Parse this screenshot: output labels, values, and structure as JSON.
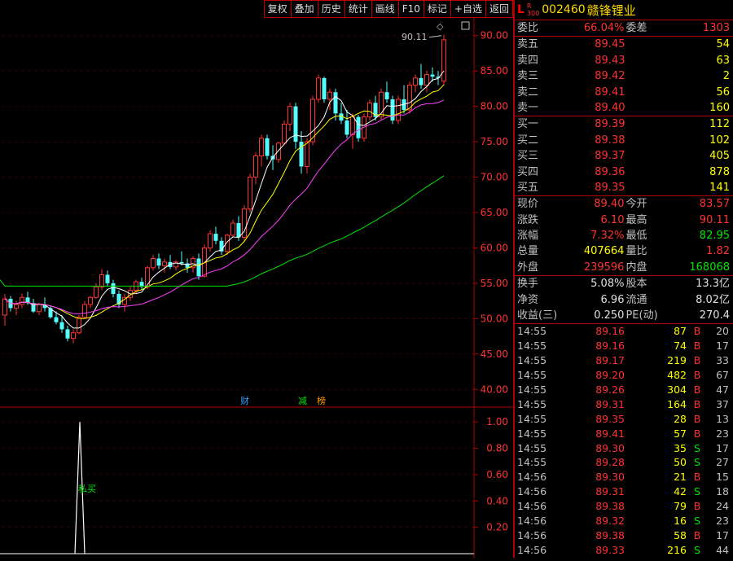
{
  "toolbar": {
    "items": [
      "复权",
      "叠加",
      "历史",
      "统计",
      "画线",
      "F10",
      "标记",
      "+自选",
      "返回"
    ]
  },
  "header": {
    "badge": "L",
    "market_top": "R",
    "market_bottom": "300",
    "code": "002460",
    "name": "赣锋锂业"
  },
  "order_book": {
    "weibi_label": "委比",
    "weibi": "66.04%",
    "weicha_label": "委差",
    "weicha": "1303",
    "asks": [
      {
        "label": "卖五",
        "price": "89.45",
        "vol": "54"
      },
      {
        "label": "卖四",
        "price": "89.43",
        "vol": "63"
      },
      {
        "label": "卖三",
        "price": "89.42",
        "vol": "2"
      },
      {
        "label": "卖二",
        "price": "89.41",
        "vol": "56"
      },
      {
        "label": "卖一",
        "price": "89.40",
        "vol": "160"
      }
    ],
    "bids": [
      {
        "label": "买一",
        "price": "89.39",
        "vol": "112"
      },
      {
        "label": "买二",
        "price": "89.38",
        "vol": "102"
      },
      {
        "label": "买三",
        "price": "89.37",
        "vol": "405"
      },
      {
        "label": "买四",
        "price": "89.36",
        "vol": "878"
      },
      {
        "label": "买五",
        "price": "89.35",
        "vol": "141"
      }
    ]
  },
  "quote": {
    "rows": [
      {
        "l1": "现价",
        "v1": "89.40",
        "l2": "今开",
        "v2": "83.57"
      },
      {
        "l1": "涨跌",
        "v1": "6.10",
        "l2": "最高",
        "v2": "90.11"
      },
      {
        "l1": "涨幅",
        "v1": "7.32%",
        "l2": "最低",
        "v2": "82.95"
      },
      {
        "l1": "总量",
        "v1": "407664",
        "l2": "量比",
        "v2": "1.82"
      },
      {
        "l1": "外盘",
        "v1": "239596",
        "l2": "内盘",
        "v2": "168068"
      }
    ],
    "rows2": [
      {
        "l1": "换手",
        "v1": "5.08%",
        "l2": "股本",
        "v2": "13.3亿"
      },
      {
        "l1": "净资",
        "v1": "6.96",
        "l2": "流通",
        "v2": "8.02亿"
      },
      {
        "l1": "收益(三)",
        "v1": "0.250",
        "l2": "PE(动)",
        "v2": "270.4"
      }
    ]
  },
  "ticks": [
    {
      "time": "14:55",
      "price": "89.16",
      "vol": "87",
      "bs": "B",
      "cnt": "20"
    },
    {
      "time": "14:55",
      "price": "89.16",
      "vol": "74",
      "bs": "B",
      "cnt": "17"
    },
    {
      "time": "14:55",
      "price": "89.17",
      "vol": "219",
      "bs": "B",
      "cnt": "33"
    },
    {
      "time": "14:55",
      "price": "89.20",
      "vol": "482",
      "bs": "B",
      "cnt": "67"
    },
    {
      "time": "14:55",
      "price": "89.26",
      "vol": "304",
      "bs": "B",
      "cnt": "47"
    },
    {
      "time": "14:55",
      "price": "89.31",
      "vol": "164",
      "bs": "B",
      "cnt": "37"
    },
    {
      "time": "14:55",
      "price": "89.35",
      "vol": "28",
      "bs": "B",
      "cnt": "13"
    },
    {
      "time": "14:55",
      "price": "89.41",
      "vol": "57",
      "bs": "B",
      "cnt": "23"
    },
    {
      "time": "14:55",
      "price": "89.30",
      "vol": "35",
      "bs": "S",
      "cnt": "17"
    },
    {
      "time": "14:55",
      "price": "89.28",
      "vol": "50",
      "bs": "S",
      "cnt": "27"
    },
    {
      "time": "14:56",
      "price": "89.30",
      "vol": "21",
      "bs": "B",
      "cnt": "15"
    },
    {
      "time": "14:56",
      "price": "89.31",
      "vol": "42",
      "bs": "S",
      "cnt": "18"
    },
    {
      "time": "14:56",
      "price": "89.38",
      "vol": "79",
      "bs": "B",
      "cnt": "24"
    },
    {
      "time": "14:56",
      "price": "89.32",
      "vol": "16",
      "bs": "S",
      "cnt": "23"
    },
    {
      "time": "14:56",
      "price": "89.38",
      "vol": "58",
      "bs": "B",
      "cnt": "17"
    },
    {
      "time": "14:56",
      "price": "89.33",
      "vol": "216",
      "bs": "S",
      "cnt": "44"
    }
  ],
  "chart_data": [
    {
      "type": "candlestick",
      "title": "",
      "y_ticks": [
        40,
        45,
        50,
        55,
        60,
        65,
        70,
        75,
        80,
        85,
        90
      ],
      "ylim": [
        37.5,
        92.5
      ],
      "max_label": "90.11",
      "event_labels": [
        {
          "text": "财",
          "color": "#3aa0ff"
        },
        {
          "text": "减",
          "color": "#00e600"
        },
        {
          "text": "榜",
          "color": "#ff9900"
        }
      ],
      "ohlc": [
        [
          50.5,
          53.5,
          49.0,
          52.8
        ],
        [
          52.8,
          53.2,
          51.0,
          51.5
        ],
        [
          51.5,
          52.5,
          50.5,
          52.0
        ],
        [
          52.0,
          53.5,
          51.5,
          53.0
        ],
        [
          53.0,
          53.8,
          52.0,
          52.2
        ],
        [
          52.2,
          52.8,
          50.8,
          51.0
        ],
        [
          51.0,
          52.2,
          50.5,
          52.0
        ],
        [
          52.0,
          53.0,
          51.0,
          51.5
        ],
        [
          51.5,
          51.8,
          50.0,
          50.2
        ],
        [
          50.2,
          51.0,
          49.2,
          49.5
        ],
        [
          49.5,
          50.5,
          48.0,
          48.5
        ],
        [
          48.5,
          49.0,
          46.8,
          47.2
        ],
        [
          47.2,
          48.5,
          46.5,
          48.0
        ],
        [
          48.0,
          50.5,
          47.8,
          50.2
        ],
        [
          50.2,
          52.5,
          50.0,
          52.0
        ],
        [
          52.0,
          53.2,
          51.5,
          53.0
        ],
        [
          53.0,
          55.0,
          52.8,
          54.5
        ],
        [
          54.5,
          57.0,
          54.0,
          56.2
        ],
        [
          56.2,
          56.8,
          54.5,
          55.0
        ],
        [
          55.0,
          55.5,
          53.0,
          53.5
        ],
        [
          53.5,
          54.0,
          51.5,
          52.0
        ],
        [
          52.0,
          53.5,
          51.0,
          53.0
        ],
        [
          53.0,
          54.5,
          52.5,
          54.0
        ],
        [
          54.0,
          55.5,
          53.5,
          55.2
        ],
        [
          55.2,
          55.8,
          54.0,
          54.5
        ],
        [
          54.5,
          57.5,
          54.2,
          57.2
        ],
        [
          57.2,
          59.0,
          56.8,
          58.5
        ],
        [
          58.5,
          59.2,
          57.0,
          57.5
        ],
        [
          57.5,
          58.5,
          56.5,
          58.0
        ],
        [
          58.0,
          59.0,
          57.0,
          57.3
        ],
        [
          57.3,
          58.3,
          56.8,
          58.0
        ],
        [
          58.0,
          59.5,
          57.5,
          57.8
        ],
        [
          57.8,
          58.5,
          56.5,
          57.2
        ],
        [
          57.2,
          58.8,
          56.5,
          58.5
        ],
        [
          58.5,
          59.2,
          55.5,
          56.0
        ],
        [
          56.0,
          60.5,
          55.8,
          60.0
        ],
        [
          60.0,
          62.5,
          59.5,
          62.0
        ],
        [
          62.0,
          63.0,
          60.5,
          61.0
        ],
        [
          61.0,
          61.5,
          59.0,
          59.5
        ],
        [
          59.5,
          62.0,
          59.0,
          61.8
        ],
        [
          61.8,
          64.0,
          61.5,
          63.5
        ],
        [
          63.5,
          64.5,
          61.0,
          61.5
        ],
        [
          61.5,
          66.0,
          61.0,
          65.5
        ],
        [
          65.5,
          70.5,
          65.0,
          70.0
        ],
        [
          70.0,
          73.5,
          69.0,
          73.0
        ],
        [
          73.0,
          76.0,
          71.5,
          75.5
        ],
        [
          75.5,
          76.0,
          72.5,
          73.0
        ],
        [
          73.0,
          74.5,
          71.0,
          72.5
        ],
        [
          72.5,
          75.0,
          72.0,
          74.8
        ],
        [
          74.8,
          78.0,
          74.5,
          77.5
        ],
        [
          77.5,
          80.5,
          76.5,
          80.0
        ],
        [
          80.0,
          80.5,
          74.0,
          75.0
        ],
        [
          75.0,
          76.5,
          70.5,
          71.5
        ],
        [
          71.5,
          75.5,
          70.5,
          75.0
        ],
        [
          75.0,
          81.5,
          74.5,
          81.0
        ],
        [
          81.0,
          84.5,
          80.5,
          84.0
        ],
        [
          84.0,
          84.2,
          80.5,
          81.0
        ],
        [
          81.0,
          82.5,
          79.5,
          82.0
        ],
        [
          82.0,
          82.5,
          78.0,
          79.0
        ],
        [
          79.0,
          80.5,
          77.5,
          78.0
        ],
        [
          78.0,
          79.5,
          75.5,
          76.0
        ],
        [
          76.0,
          79.0,
          74.0,
          78.5
        ],
        [
          78.5,
          78.8,
          75.0,
          75.5
        ],
        [
          75.5,
          79.0,
          75.0,
          78.5
        ],
        [
          78.5,
          81.0,
          78.0,
          80.5
        ],
        [
          80.5,
          81.5,
          78.0,
          78.5
        ],
        [
          78.5,
          82.5,
          78.0,
          82.0
        ],
        [
          82.0,
          83.5,
          80.5,
          81.0
        ],
        [
          81.0,
          81.5,
          77.5,
          78.0
        ],
        [
          78.0,
          81.5,
          77.5,
          81.0
        ],
        [
          81.0,
          83.0,
          79.0,
          79.5
        ],
        [
          79.5,
          83.5,
          79.0,
          83.0
        ],
        [
          83.0,
          84.5,
          82.0,
          84.0
        ],
        [
          84.0,
          86.0,
          82.5,
          83.0
        ],
        [
          83.0,
          85.0,
          82.0,
          84.5
        ],
        [
          84.5,
          85.5,
          83.5,
          84.2
        ],
        [
          84.2,
          85.0,
          83.0,
          84.0
        ],
        [
          83.57,
          90.11,
          82.95,
          89.4
        ]
      ]
    },
    {
      "type": "line",
      "title": "",
      "y_ticks": [
        0.2,
        0.4,
        0.6,
        0.8,
        1.0
      ],
      "ylim": [
        0,
        1.1
      ],
      "signal_label": "私买",
      "spike_index": 13
    }
  ]
}
